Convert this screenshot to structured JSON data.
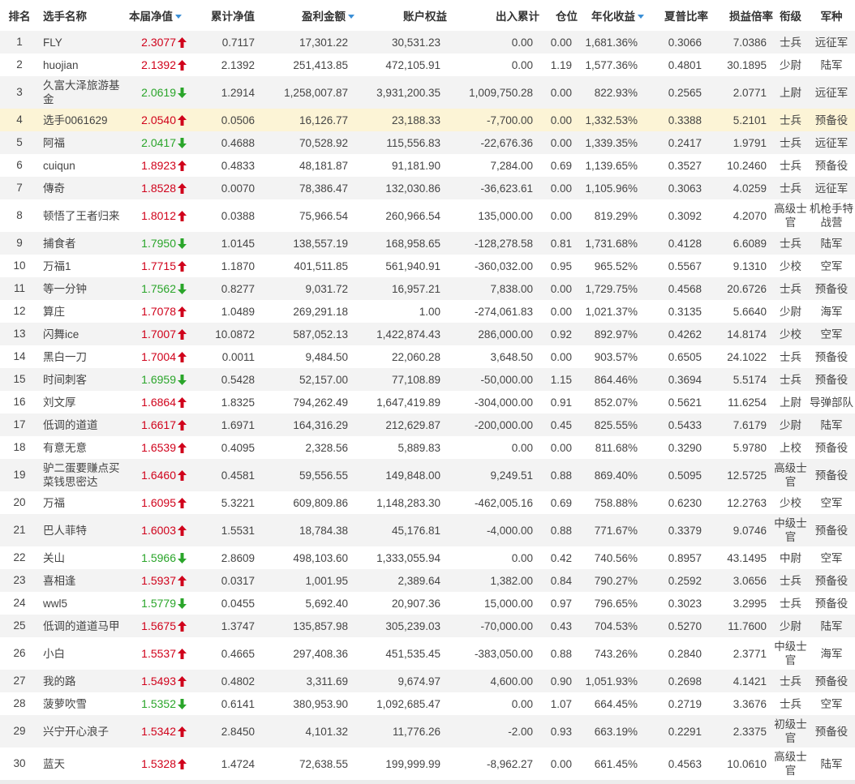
{
  "colors": {
    "up": "#d0021b",
    "down": "#2aa52a",
    "highlight_row": "#fcf4d6",
    "stripe": "#f3f3f3",
    "sort_arrow": "#3b8fd6"
  },
  "headers": {
    "rank": "排名",
    "name": "选手名称",
    "nav": "本届净值",
    "cum_nav": "累计净值",
    "profit": "盈利金额",
    "equity": "账户权益",
    "inout": "出入累计",
    "position": "仓位",
    "annual": "年化收益",
    "sharpe": "夏普比率",
    "pl_ratio": "损益倍率",
    "rank_title": "衔级",
    "branch": "军种"
  },
  "rows": [
    {
      "rank": "1",
      "name": "FLY",
      "nav": "2.3077",
      "dir": "up",
      "cum_nav": "0.7117",
      "profit": "17,301.22",
      "equity": "30,531.23",
      "inout": "0.00",
      "position": "0.00",
      "annual": "1,681.36%",
      "sharpe": "0.3066",
      "pl_ratio": "7.0386",
      "title": "士兵",
      "branch": "远征军"
    },
    {
      "rank": "2",
      "name": "huojian",
      "nav": "2.1392",
      "dir": "up",
      "cum_nav": "2.1392",
      "profit": "251,413.85",
      "equity": "472,105.91",
      "inout": "0.00",
      "position": "1.19",
      "annual": "1,577.36%",
      "sharpe": "0.4801",
      "pl_ratio": "30.1895",
      "title": "少尉",
      "branch": "陆军"
    },
    {
      "rank": "3",
      "name": "久富大泽旅游基金",
      "nav": "2.0619",
      "dir": "down",
      "cum_nav": "1.2914",
      "profit": "1,258,007.87",
      "equity": "3,931,200.35",
      "inout": "1,009,750.28",
      "position": "0.00",
      "annual": "822.93%",
      "sharpe": "0.2565",
      "pl_ratio": "2.0771",
      "title": "上尉",
      "branch": "远征军",
      "tall": true
    },
    {
      "rank": "4",
      "name": "选手0061629",
      "nav": "2.0540",
      "dir": "up",
      "cum_nav": "0.0506",
      "profit": "16,126.77",
      "equity": "23,188.33",
      "inout": "-7,700.00",
      "position": "0.00",
      "annual": "1,332.53%",
      "sharpe": "0.3388",
      "pl_ratio": "5.2101",
      "title": "士兵",
      "branch": "预备役",
      "highlight": true
    },
    {
      "rank": "5",
      "name": "阿福",
      "nav": "2.0417",
      "dir": "down",
      "cum_nav": "0.4688",
      "profit": "70,528.92",
      "equity": "115,556.83",
      "inout": "-22,676.36",
      "position": "0.00",
      "annual": "1,339.35%",
      "sharpe": "0.2417",
      "pl_ratio": "1.9791",
      "title": "士兵",
      "branch": "远征军"
    },
    {
      "rank": "6",
      "name": "cuiqun",
      "nav": "1.8923",
      "dir": "up",
      "cum_nav": "0.4833",
      "profit": "48,181.87",
      "equity": "91,181.90",
      "inout": "7,284.00",
      "position": "0.69",
      "annual": "1,139.65%",
      "sharpe": "0.3527",
      "pl_ratio": "10.2460",
      "title": "士兵",
      "branch": "预备役"
    },
    {
      "rank": "7",
      "name": "傳奇",
      "nav": "1.8528",
      "dir": "up",
      "cum_nav": "0.0070",
      "profit": "78,386.47",
      "equity": "132,030.86",
      "inout": "-36,623.61",
      "position": "0.00",
      "annual": "1,105.96%",
      "sharpe": "0.3063",
      "pl_ratio": "4.0259",
      "title": "士兵",
      "branch": "远征军"
    },
    {
      "rank": "8",
      "name": "顿悟了王者归来",
      "nav": "1.8012",
      "dir": "up",
      "cum_nav": "0.0388",
      "profit": "75,966.54",
      "equity": "260,966.54",
      "inout": "135,000.00",
      "position": "0.00",
      "annual": "819.29%",
      "sharpe": "0.3092",
      "pl_ratio": "4.2070",
      "title": "高级士官",
      "branch": "机枪手特战营",
      "tall": true
    },
    {
      "rank": "9",
      "name": "捕食者",
      "nav": "1.7950",
      "dir": "down",
      "cum_nav": "1.0145",
      "profit": "138,557.19",
      "equity": "168,958.65",
      "inout": "-128,278.58",
      "position": "0.81",
      "annual": "1,731.68%",
      "sharpe": "0.4128",
      "pl_ratio": "6.6089",
      "title": "士兵",
      "branch": "陆军"
    },
    {
      "rank": "10",
      "name": "万福1",
      "nav": "1.7715",
      "dir": "up",
      "cum_nav": "1.1870",
      "profit": "401,511.85",
      "equity": "561,940.91",
      "inout": "-360,032.00",
      "position": "0.95",
      "annual": "965.52%",
      "sharpe": "0.5567",
      "pl_ratio": "9.1310",
      "title": "少校",
      "branch": "空军"
    },
    {
      "rank": "11",
      "name": "等一分钟",
      "nav": "1.7562",
      "dir": "down",
      "cum_nav": "0.8277",
      "profit": "9,031.72",
      "equity": "16,957.21",
      "inout": "7,838.00",
      "position": "0.00",
      "annual": "1,729.75%",
      "sharpe": "0.4568",
      "pl_ratio": "20.6726",
      "title": "士兵",
      "branch": "预备役"
    },
    {
      "rank": "12",
      "name": "算庄",
      "nav": "1.7078",
      "dir": "up",
      "cum_nav": "1.0489",
      "profit": "269,291.18",
      "equity": "1.00",
      "inout": "-274,061.83",
      "position": "0.00",
      "annual": "1,021.37%",
      "sharpe": "0.3135",
      "pl_ratio": "5.6640",
      "title": "少尉",
      "branch": "海军"
    },
    {
      "rank": "13",
      "name": "闪舞ice",
      "nav": "1.7007",
      "dir": "up",
      "cum_nav": "10.0872",
      "profit": "587,052.13",
      "equity": "1,422,874.43",
      "inout": "286,000.00",
      "position": "0.92",
      "annual": "892.97%",
      "sharpe": "0.4262",
      "pl_ratio": "14.8174",
      "title": "少校",
      "branch": "空军"
    },
    {
      "rank": "14",
      "name": "黑白一刀",
      "nav": "1.7004",
      "dir": "up",
      "cum_nav": "0.0011",
      "profit": "9,484.50",
      "equity": "22,060.28",
      "inout": "3,648.50",
      "position": "0.00",
      "annual": "903.57%",
      "sharpe": "0.6505",
      "pl_ratio": "24.1022",
      "title": "士兵",
      "branch": "预备役"
    },
    {
      "rank": "15",
      "name": "时间刺客",
      "nav": "1.6959",
      "dir": "down",
      "cum_nav": "0.5428",
      "profit": "52,157.00",
      "equity": "77,108.89",
      "inout": "-50,000.00",
      "position": "1.15",
      "annual": "864.46%",
      "sharpe": "0.3694",
      "pl_ratio": "5.5174",
      "title": "士兵",
      "branch": "预备役"
    },
    {
      "rank": "16",
      "name": "刘文厚",
      "nav": "1.6864",
      "dir": "up",
      "cum_nav": "1.8325",
      "profit": "794,262.49",
      "equity": "1,647,419.89",
      "inout": "-304,000.00",
      "position": "0.91",
      "annual": "852.07%",
      "sharpe": "0.5621",
      "pl_ratio": "11.6254",
      "title": "上尉",
      "branch": "导弹部队"
    },
    {
      "rank": "17",
      "name": "低调的道道",
      "nav": "1.6617",
      "dir": "up",
      "cum_nav": "1.6971",
      "profit": "164,316.29",
      "equity": "212,629.87",
      "inout": "-200,000.00",
      "position": "0.45",
      "annual": "825.55%",
      "sharpe": "0.5433",
      "pl_ratio": "7.6179",
      "title": "少尉",
      "branch": "陆军"
    },
    {
      "rank": "18",
      "name": "有意无意",
      "nav": "1.6539",
      "dir": "up",
      "cum_nav": "0.4095",
      "profit": "2,328.56",
      "equity": "5,889.83",
      "inout": "0.00",
      "position": "0.00",
      "annual": "811.68%",
      "sharpe": "0.3290",
      "pl_ratio": "5.9780",
      "title": "上校",
      "branch": "预备役"
    },
    {
      "rank": "19",
      "name": "驴二蛋要赚点买菜钱思密达",
      "nav": "1.6460",
      "dir": "up",
      "cum_nav": "0.4581",
      "profit": "59,556.55",
      "equity": "149,848.00",
      "inout": "9,249.51",
      "position": "0.88",
      "annual": "869.40%",
      "sharpe": "0.5095",
      "pl_ratio": "12.5725",
      "title": "高级士官",
      "branch": "预备役",
      "tall": true
    },
    {
      "rank": "20",
      "name": "万福",
      "nav": "1.6095",
      "dir": "up",
      "cum_nav": "5.3221",
      "profit": "609,809.86",
      "equity": "1,148,283.30",
      "inout": "-462,005.16",
      "position": "0.69",
      "annual": "758.88%",
      "sharpe": "0.6230",
      "pl_ratio": "12.2763",
      "title": "少校",
      "branch": "空军"
    },
    {
      "rank": "21",
      "name": "巴人菲特",
      "nav": "1.6003",
      "dir": "up",
      "cum_nav": "1.5531",
      "profit": "18,784.38",
      "equity": "45,176.81",
      "inout": "-4,000.00",
      "position": "0.88",
      "annual": "771.67%",
      "sharpe": "0.3379",
      "pl_ratio": "9.0746",
      "title": "中级士官",
      "branch": "预备役",
      "tall": true
    },
    {
      "rank": "22",
      "name": "关山",
      "nav": "1.5966",
      "dir": "down",
      "cum_nav": "2.8609",
      "profit": "498,103.60",
      "equity": "1,333,055.94",
      "inout": "0.00",
      "position": "0.42",
      "annual": "740.56%",
      "sharpe": "0.8957",
      "pl_ratio": "43.1495",
      "title": "中尉",
      "branch": "空军"
    },
    {
      "rank": "23",
      "name": "喜相逢",
      "nav": "1.5937",
      "dir": "up",
      "cum_nav": "0.0317",
      "profit": "1,001.95",
      "equity": "2,389.64",
      "inout": "1,382.00",
      "position": "0.84",
      "annual": "790.27%",
      "sharpe": "0.2592",
      "pl_ratio": "3.0656",
      "title": "士兵",
      "branch": "预备役"
    },
    {
      "rank": "24",
      "name": "wwl5",
      "nav": "1.5779",
      "dir": "down",
      "cum_nav": "0.0455",
      "profit": "5,692.40",
      "equity": "20,907.36",
      "inout": "15,000.00",
      "position": "0.97",
      "annual": "796.65%",
      "sharpe": "0.3023",
      "pl_ratio": "3.2995",
      "title": "士兵",
      "branch": "预备役"
    },
    {
      "rank": "25",
      "name": "低调的道道马甲",
      "nav": "1.5675",
      "dir": "up",
      "cum_nav": "1.3747",
      "profit": "135,857.98",
      "equity": "305,239.03",
      "inout": "-70,000.00",
      "position": "0.43",
      "annual": "704.53%",
      "sharpe": "0.5270",
      "pl_ratio": "11.7600",
      "title": "少尉",
      "branch": "陆军"
    },
    {
      "rank": "26",
      "name": "小白",
      "nav": "1.5537",
      "dir": "up",
      "cum_nav": "0.4665",
      "profit": "297,408.36",
      "equity": "451,535.45",
      "inout": "-383,050.00",
      "position": "0.88",
      "annual": "743.26%",
      "sharpe": "0.2840",
      "pl_ratio": "2.3771",
      "title": "中级士官",
      "branch": "海军",
      "tall": true
    },
    {
      "rank": "27",
      "name": "我的路",
      "nav": "1.5493",
      "dir": "up",
      "cum_nav": "0.4802",
      "profit": "3,311.69",
      "equity": "9,674.97",
      "inout": "4,600.00",
      "position": "0.90",
      "annual": "1,051.93%",
      "sharpe": "0.2698",
      "pl_ratio": "4.1421",
      "title": "士兵",
      "branch": "预备役"
    },
    {
      "rank": "28",
      "name": "菠萝吹雪",
      "nav": "1.5352",
      "dir": "down",
      "cum_nav": "0.6141",
      "profit": "380,953.90",
      "equity": "1,092,685.47",
      "inout": "0.00",
      "position": "1.07",
      "annual": "664.45%",
      "sharpe": "0.2719",
      "pl_ratio": "3.3676",
      "title": "士兵",
      "branch": "空军"
    },
    {
      "rank": "29",
      "name": "兴宁开心浪子",
      "nav": "1.5342",
      "dir": "up",
      "cum_nav": "2.8450",
      "profit": "4,101.32",
      "equity": "11,776.26",
      "inout": "-2.00",
      "position": "0.93",
      "annual": "663.19%",
      "sharpe": "0.2291",
      "pl_ratio": "2.3375",
      "title": "初级士官",
      "branch": "预备役",
      "tall": true
    },
    {
      "rank": "30",
      "name": "蓝天",
      "nav": "1.5328",
      "dir": "up",
      "cum_nav": "1.4724",
      "profit": "72,638.55",
      "equity": "199,999.99",
      "inout": "-8,962.27",
      "position": "0.00",
      "annual": "661.45%",
      "sharpe": "0.4563",
      "pl_ratio": "10.0610",
      "title": "高级士官",
      "branch": "陆军",
      "tall": true
    }
  ]
}
